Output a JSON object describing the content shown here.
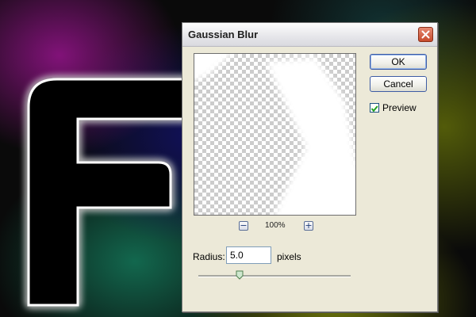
{
  "dialog": {
    "title": "Gaussian Blur",
    "ok_label": "OK",
    "cancel_label": "Cancel",
    "preview_label": "Preview",
    "preview_checked": true,
    "zoom_level": "100%",
    "zoom_out_icon": "minus-icon",
    "zoom_in_icon": "plus-icon",
    "radius_label": "Radius:",
    "radius_value": "5.0",
    "radius_units": "pixels",
    "slider_fraction": 0.27,
    "close_icon": "close-icon"
  },
  "colors": {
    "dialog_bg": "#ece9d8",
    "close_button": "#c74a2c",
    "button_border": "#3e5ca4",
    "checkmark": "#21a121"
  }
}
